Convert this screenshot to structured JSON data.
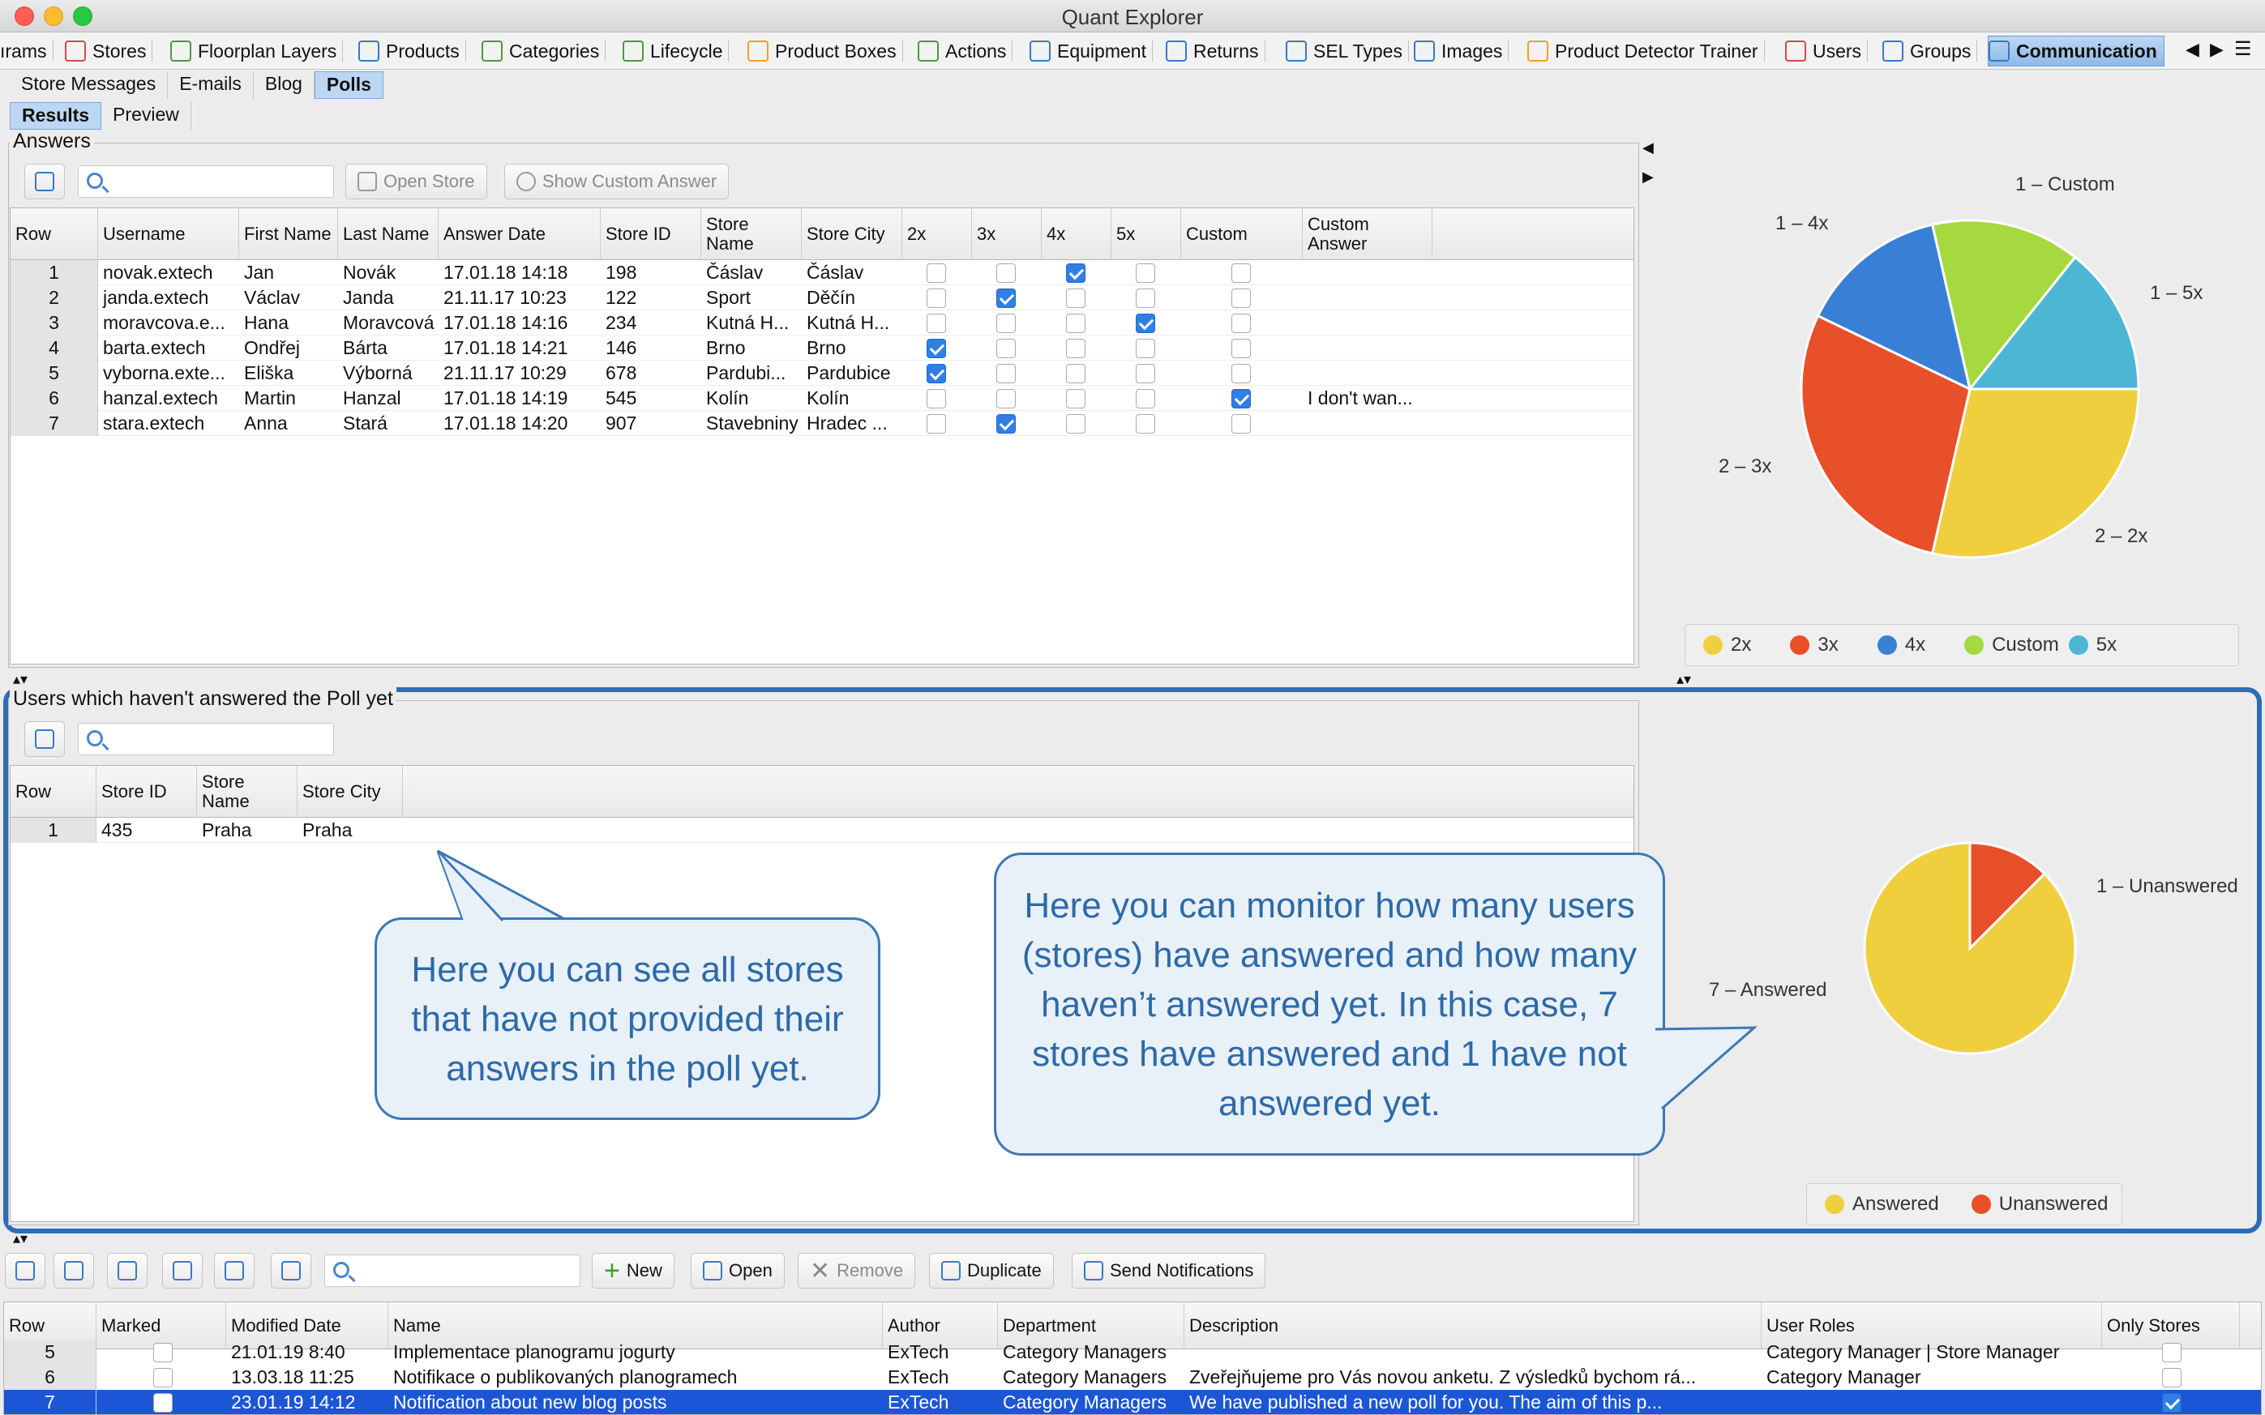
{
  "window": {
    "title": "Quant Explorer"
  },
  "module_tabs": [
    {
      "label": "ırams",
      "icon": "diagram-icon"
    },
    {
      "label": "Stores",
      "icon": "cart-icon"
    },
    {
      "label": "Floorplan Layers",
      "icon": "layers-icon"
    },
    {
      "label": "Products",
      "icon": "product-icon"
    },
    {
      "label": "Categories",
      "icon": "list-icon"
    },
    {
      "label": "Lifecycle",
      "icon": "lifecycle-icon"
    },
    {
      "label": "Product Boxes",
      "icon": "box-icon"
    },
    {
      "label": "Actions",
      "icon": "clock-icon"
    },
    {
      "label": "Equipment",
      "icon": "equipment-icon"
    },
    {
      "label": "Returns",
      "icon": "returns-icon"
    },
    {
      "label": "SEL Types",
      "icon": "tag-icon"
    },
    {
      "label": "Images",
      "icon": "image-icon"
    },
    {
      "label": "Product Detector Trainer",
      "icon": "detector-icon"
    },
    {
      "label": "Users",
      "icon": "user-icon"
    },
    {
      "label": "Groups",
      "icon": "group-icon"
    },
    {
      "label": "Communication",
      "icon": "mail-icon",
      "active": true
    }
  ],
  "sub_tabs": {
    "level1": [
      "Store Messages",
      "E-mails",
      "Blog",
      "Polls"
    ],
    "level1_active": "Polls",
    "level2": [
      "Results",
      "Preview"
    ],
    "level2_active": "Results"
  },
  "answers_panel": {
    "title": "Answers",
    "search_placeholder": "",
    "open_store_label": "Open Store",
    "show_custom_label": "Show Custom Answer",
    "columns": [
      "Row",
      "Username",
      "First Name",
      "Last Name",
      "Answer Date",
      "Store ID",
      "Store Name",
      "Store City",
      "2x",
      "3x",
      "4x",
      "5x",
      "Custom",
      "Custom Answer"
    ],
    "rows": [
      {
        "row": "1",
        "username": "novak.extech",
        "first": "Jan",
        "last": "Novák",
        "date": "17.01.18 14:18",
        "store_id": "198",
        "store_name": "Čáslav",
        "city": "Čáslav",
        "c2": false,
        "c3": false,
        "c4": true,
        "c5": false,
        "custom": false,
        "custom_answer": ""
      },
      {
        "row": "2",
        "username": "janda.extech",
        "first": "Václav",
        "last": "Janda",
        "date": "21.11.17 10:23",
        "store_id": "122",
        "store_name": "Sport",
        "city": "Děčín",
        "c2": false,
        "c3": true,
        "c4": false,
        "c5": false,
        "custom": false,
        "custom_answer": ""
      },
      {
        "row": "3",
        "username": "moravcova.e...",
        "first": "Hana",
        "last": "Moravcová",
        "date": "17.01.18 14:16",
        "store_id": "234",
        "store_name": "Kutná H...",
        "city": "Kutná H...",
        "c2": false,
        "c3": false,
        "c4": false,
        "c5": true,
        "custom": false,
        "custom_answer": ""
      },
      {
        "row": "4",
        "username": "barta.extech",
        "first": "Ondřej",
        "last": "Bárta",
        "date": "17.01.18 14:21",
        "store_id": "146",
        "store_name": "Brno",
        "city": "Brno",
        "c2": true,
        "c3": false,
        "c4": false,
        "c5": false,
        "custom": false,
        "custom_answer": ""
      },
      {
        "row": "5",
        "username": "vyborna.exte...",
        "first": "Eliška",
        "last": "Výborná",
        "date": "21.11.17 10:29",
        "store_id": "678",
        "store_name": "Pardubi...",
        "city": "Pardubice",
        "c2": true,
        "c3": false,
        "c4": false,
        "c5": false,
        "custom": false,
        "custom_answer": ""
      },
      {
        "row": "6",
        "username": "hanzal.extech",
        "first": "Martin",
        "last": "Hanzal",
        "date": "17.01.18 14:19",
        "store_id": "545",
        "store_name": "Kolín",
        "city": "Kolín",
        "c2": false,
        "c3": false,
        "c4": false,
        "c5": false,
        "custom": true,
        "custom_answer": "I don't wan..."
      },
      {
        "row": "7",
        "username": "stara.extech",
        "first": "Anna",
        "last": "Stará",
        "date": "17.01.18 14:20",
        "store_id": "907",
        "store_name": "Stavebniny",
        "city": "Hradec ...",
        "c2": false,
        "c3": true,
        "c4": false,
        "c5": false,
        "custom": false,
        "custom_answer": ""
      }
    ]
  },
  "answers_chart": {
    "labels": [
      "1 – Custom",
      "1 – 4x",
      "1 – 5x",
      "2 – 3x",
      "2 – 2x"
    ],
    "legend": [
      "2x",
      "3x",
      "4x",
      "Custom",
      "5x"
    ],
    "colors": {
      "2x": "#efcf3d",
      "3x": "#e8502a",
      "4x": "#3a7fd6",
      "Custom": "#a6d83f",
      "5x": "#4db6d4"
    }
  },
  "chart_data": [
    {
      "type": "pie",
      "categories": [
        "2x",
        "3x",
        "4x",
        "Custom",
        "5x"
      ],
      "values": [
        2,
        2,
        1,
        1,
        1
      ],
      "slice_labels": [
        "2 – 2x",
        "2 – 3x",
        "1 – 4x",
        "1 – Custom",
        "1 – 5x"
      ],
      "legend": [
        "2x",
        "3x",
        "4x",
        "Custom",
        "5x"
      ],
      "legend_position": "bottom"
    },
    {
      "type": "pie",
      "categories": [
        "Answered",
        "Unanswered"
      ],
      "values": [
        7,
        1
      ],
      "slice_labels": [
        "7 – Answered",
        "1 – Unanswered"
      ],
      "legend": [
        "Answered",
        "Unanswered"
      ],
      "legend_position": "bottom"
    }
  ],
  "unanswered_panel": {
    "title": "Users which haven't answered the Poll yet",
    "columns": [
      "Row",
      "Store ID",
      "Store Name",
      "Store City"
    ],
    "rows": [
      {
        "row": "1",
        "store_id": "435",
        "store_name": "Praha",
        "city": "Praha"
      }
    ]
  },
  "status_chart": {
    "labels": [
      "1 – Unanswered",
      "7 – Answered"
    ],
    "legend": [
      "Answered",
      "Unanswered"
    ],
    "colors": {
      "Answered": "#efcf3d",
      "Unanswered": "#e8502a"
    }
  },
  "callouts": {
    "left": "Here you can see all stores that have not provided their answers in the poll yet.",
    "right": "Here you can monitor how many users (stores) have answered and how many haven’t answered yet. In this case, 7 stores have answered and 1 have not answered yet."
  },
  "bottom_toolbar": {
    "new_label": "New",
    "open_label": "Open",
    "remove_label": "Remove",
    "duplicate_label": "Duplicate",
    "send_label": "Send Notifications"
  },
  "polls_table": {
    "columns": [
      "Row",
      "Marked",
      "Modified Date",
      "Name",
      "Author",
      "Department",
      "Description",
      "User Roles",
      "Only Stores"
    ],
    "rows": [
      {
        "row": "5",
        "marked": false,
        "date": "21.01.19 8:40",
        "name": "Implementace planogramu jogurty",
        "author": "ExTech",
        "department": "Category Managers",
        "description": "",
        "roles": "Category Manager | Store Manager",
        "only_stores": false,
        "selected": false
      },
      {
        "row": "6",
        "marked": false,
        "date": "13.03.18 11:25",
        "name": "Notifikace o publikovaných planogramech",
        "author": "ExTech",
        "department": "Category Managers",
        "description": "Zveřejňujeme pro Vás novou anketu. Z výsledků bychom rá...",
        "roles": "Category Manager",
        "only_stores": false,
        "selected": false
      },
      {
        "row": "7",
        "marked": false,
        "date": "23.01.19 14:12",
        "name": "Notification about new blog posts",
        "author": "ExTech",
        "department": "Category Managers",
        "description": "We have published a new poll for you. The aim of this p...",
        "roles": "",
        "only_stores": true,
        "selected": true
      }
    ]
  }
}
